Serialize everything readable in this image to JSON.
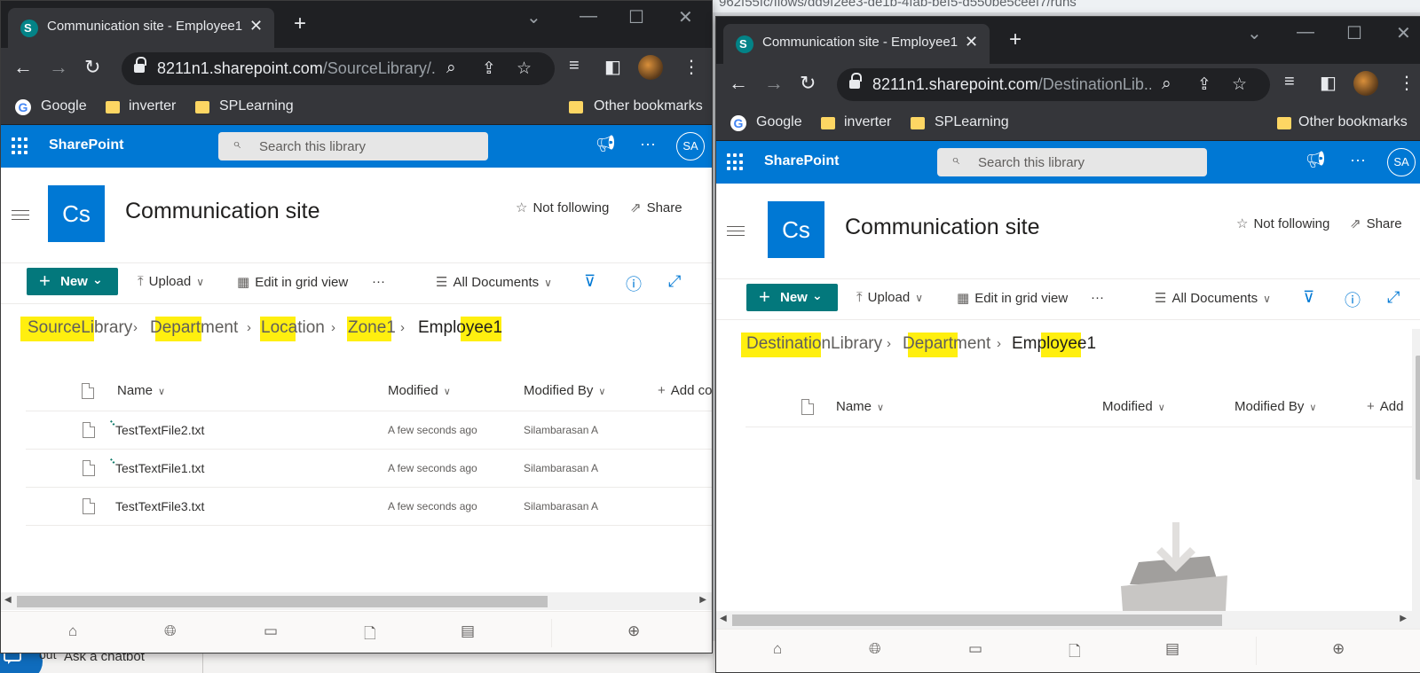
{
  "background": {
    "url_fragment": "962f55fc/flows/dd9f2ee3-de1b-4fab-bef5-d550be5ceef7/runs",
    "chatbot_text": "Ask a chatbot",
    "partial_text": "out"
  },
  "left": {
    "tab_title": "Communication site - Employee1",
    "url_host": "8211n1.sharepoint.com",
    "url_path": "/SourceLibrary/...",
    "bookmarks": [
      "Google",
      "inverter",
      "SPLearning",
      "Other bookmarks"
    ],
    "suite_title": "SharePoint",
    "search_placeholder": "Search this library",
    "user_initials": "SA",
    "site_logo": "Cs",
    "site_title": "Communication site",
    "following": "Not following",
    "share": "Share",
    "cmd": {
      "new": "New",
      "upload": "Upload",
      "edit_grid": "Edit in grid view",
      "view": "All Documents"
    },
    "breadcrumb": [
      "SourceLibrary",
      "Department",
      "Location",
      "Zone1",
      "Employee1"
    ],
    "columns": {
      "name": "Name",
      "modified": "Modified",
      "modified_by": "Modified By",
      "add_col": "Add co"
    },
    "files": [
      {
        "name": "TestTextFile2.txt",
        "modified": "A few seconds ago",
        "modified_by": "Silambarasan A",
        "is_new": true
      },
      {
        "name": "TestTextFile1.txt",
        "modified": "A few seconds ago",
        "modified_by": "Silambarasan A",
        "is_new": true
      },
      {
        "name": "TestTextFile3.txt",
        "modified": "A few seconds ago",
        "modified_by": "Silambarasan A",
        "is_new": false
      }
    ]
  },
  "right": {
    "tab_title": "Communication site - Employee1",
    "url_host": "8211n1.sharepoint.com",
    "url_path": "/DestinationLib...",
    "bookmarks": [
      "Google",
      "inverter",
      "SPLearning",
      "Other bookmarks"
    ],
    "suite_title": "SharePoint",
    "search_placeholder": "Search this library",
    "user_initials": "SA",
    "site_logo": "Cs",
    "site_title": "Communication site",
    "following": "Not following",
    "share": "Share",
    "cmd": {
      "new": "New",
      "upload": "Upload",
      "edit_grid": "Edit in grid view",
      "view": "All Documents"
    },
    "breadcrumb": [
      "DestinationLibrary",
      "Department",
      "Employee1"
    ],
    "columns": {
      "name": "Name",
      "modified": "Modified",
      "modified_by": "Modified By",
      "add_col": "Add"
    }
  },
  "colors": {
    "suite_bar": "#0078d4",
    "new_button": "#03787c",
    "highlight": "#ffef0f",
    "browser_dark": "#35363a"
  }
}
